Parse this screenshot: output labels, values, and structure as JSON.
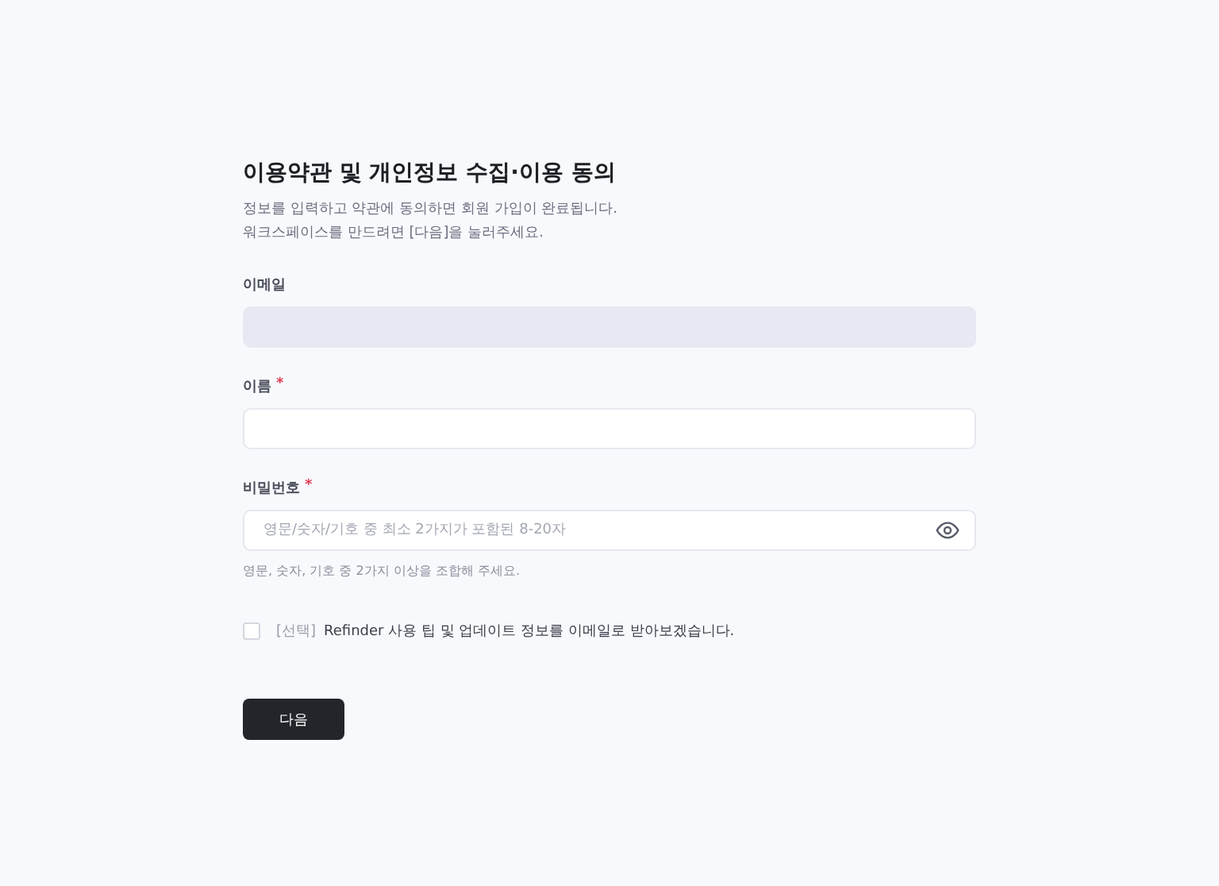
{
  "title": "이용약관 및 개인정보 수집·이용 동의",
  "description": [
    "정보를 입력하고 약관에 동의하면 회원 가입이 완료됩니다.",
    "워크스페이스를 만드려면 [다음]을 눌러주세요."
  ],
  "fields": [
    {
      "label": "이메일",
      "disabled": true,
      "kind": "text"
    },
    {
      "label": "이름",
      "required_mark": "*",
      "disabled": false,
      "kind": "text"
    },
    {
      "label": "비밀번호",
      "required_mark": "*",
      "disabled": false,
      "kind": "password",
      "placeholder": "영문/숫자/기호 중 최소 2가지가 포함된 8-20자",
      "hint": "영문, 숫자, 기호 중 2가지 이상을 조합해 주세요."
    }
  ],
  "consent": {
    "checked": false,
    "prefix": "[선택]",
    "label": "Refinder 사용 팁 및 업데이트 정보를 이메일로 받아보겠습니다."
  },
  "next_button": "다음"
}
